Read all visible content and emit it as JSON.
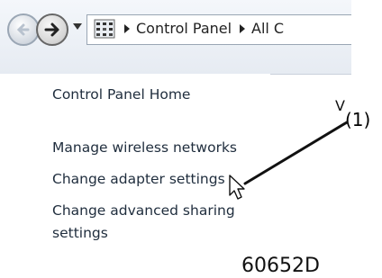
{
  "nav": {
    "breadcrumb": [
      "Control Panel",
      "All C"
    ]
  },
  "sidebar": {
    "items": [
      {
        "label": "Control Panel Home"
      },
      {
        "label": "Manage wireless networks"
      },
      {
        "label": "Change adapter settings"
      },
      {
        "label": "Change advanced sharing"
      },
      {
        "label": "settings"
      }
    ]
  },
  "annotation": {
    "partial_text": "V",
    "callout_label": "(1)",
    "figure_code": "60652D"
  },
  "colors": {
    "link_text": "#1f2d3d",
    "callout_line": "#111111"
  },
  "icons": [
    "back-arrow-icon",
    "forward-arrow-icon",
    "chevron-down-icon",
    "control-panel-icon",
    "breadcrumb-arrow-icon",
    "mouse-cursor-icon"
  ]
}
